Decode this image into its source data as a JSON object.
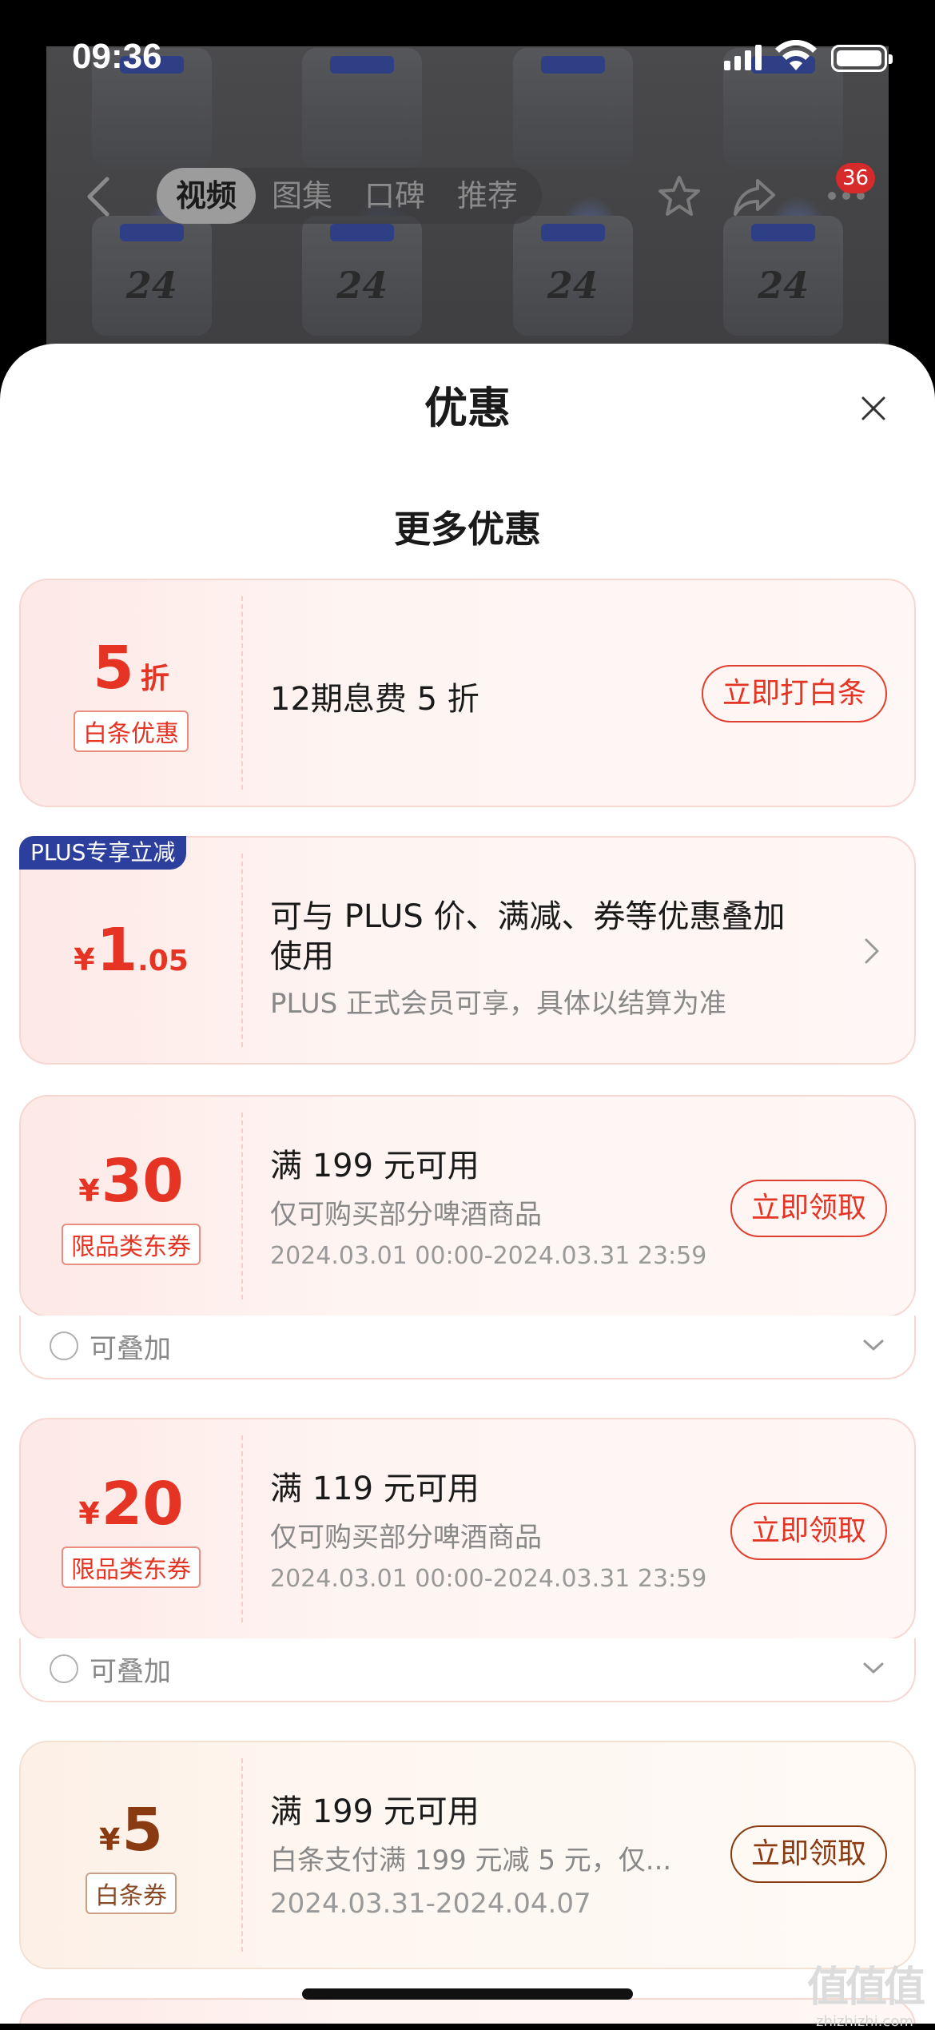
{
  "status_bar": {
    "time": "09:36"
  },
  "nav": {
    "tabs": [
      {
        "label": "视频",
        "active": true
      },
      {
        "label": "图集",
        "active": false
      },
      {
        "label": "口碑",
        "active": false
      },
      {
        "label": "推荐",
        "active": false
      }
    ],
    "badge_count": "36"
  },
  "background": {
    "bottle_text": "24"
  },
  "sheet": {
    "title": "优惠",
    "section_title": "更多优惠"
  },
  "offers": {
    "baitiao": {
      "amount": "5",
      "unit": "折",
      "tag": "白条优惠",
      "text": "12期息费 5 折",
      "button": "立即打白条"
    },
    "plus": {
      "badge": "PLUS专享立减",
      "yen": "¥",
      "amount_int": "1",
      "amount_dec": ".05",
      "title_line1": "可与 PLUS 价、满减、券等优惠叠加",
      "title_line2": "使用",
      "subtitle": "PLUS 正式会员可享，具体以结算为准"
    },
    "coupon30": {
      "yen": "¥",
      "amount": "30",
      "tag": "限品类东券",
      "title": "满 199 元可用",
      "subtitle": "仅可购买部分啤酒商品",
      "date": "2024.03.01 00:00-2024.03.31 23:59",
      "button": "立即领取",
      "stack": "可叠加"
    },
    "coupon20": {
      "yen": "¥",
      "amount": "20",
      "tag": "限品类东券",
      "title": "满 119 元可用",
      "subtitle": "仅可购买部分啤酒商品",
      "date": "2024.03.01 00:00-2024.03.31 23:59",
      "button": "立即领取",
      "stack": "可叠加"
    },
    "coupon5": {
      "yen": "¥",
      "amount": "5",
      "tag": "白条券",
      "title": "满 199 元可用",
      "subtitle": "白条支付满 199 元减 5 元，仅...",
      "date": "2024.03.31-2024.04.07",
      "button": "立即领取"
    }
  },
  "watermark": {
    "logo": "值值值",
    "url": "zhizhizhi.com"
  },
  "colors": {
    "accent_red": "#e53424",
    "plus_blue": "#2d3f9c",
    "brown": "#8a3a10"
  }
}
